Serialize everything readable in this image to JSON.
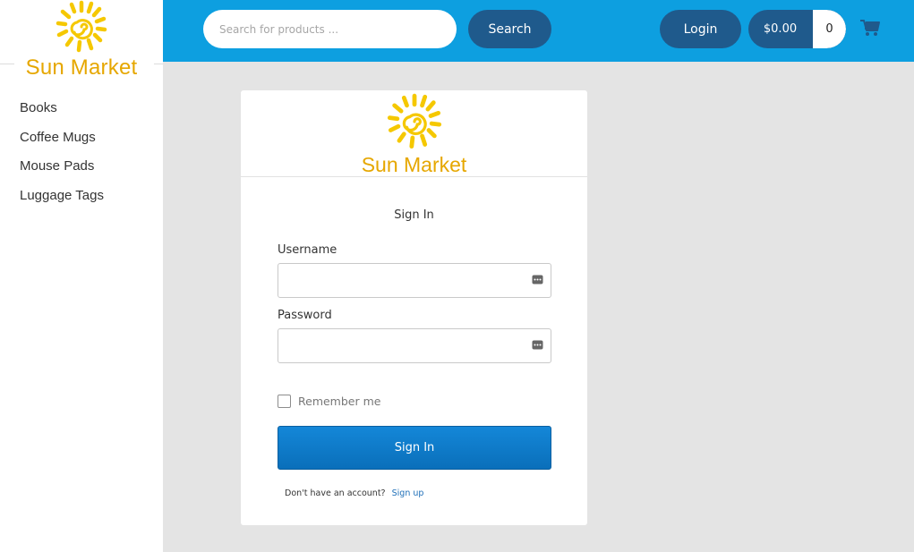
{
  "brand": {
    "name": "Sun Market",
    "color": "#e6a700",
    "logo_icon": "sun-logo-icon"
  },
  "sidebar": {
    "items": [
      {
        "label": "Books"
      },
      {
        "label": "Coffee Mugs"
      },
      {
        "label": "Mouse Pads"
      },
      {
        "label": "Luggage Tags"
      }
    ]
  },
  "header": {
    "background": "#0d9fe0",
    "search": {
      "placeholder": "Search for products ...",
      "value": ""
    },
    "search_button": "Search",
    "login_button": "Login",
    "cart": {
      "total": "$0.00",
      "count": "0",
      "icon": "shopping-cart-icon"
    }
  },
  "signin": {
    "title": "Sign In",
    "username_label": "Username",
    "username_value": "",
    "password_label": "Password",
    "password_value": "",
    "field_icon": "password-manager-key-icon",
    "remember_label": "Remember me",
    "remember_checked": false,
    "submit_label": "Sign In",
    "no_account_text": "Don't have an account?",
    "signup_link": "Sign up",
    "button_color": "#0a6fba"
  }
}
